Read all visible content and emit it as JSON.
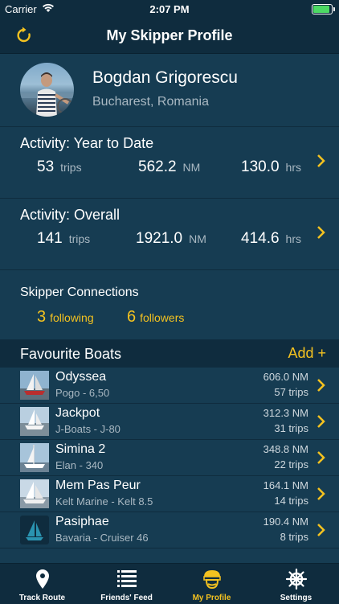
{
  "status_bar": {
    "carrier": "Carrier",
    "time": "2:07 PM"
  },
  "nav": {
    "title": "My Skipper Profile",
    "refresh_icon": "refresh-icon"
  },
  "profile": {
    "name": "Bogdan Grigorescu",
    "location": "Bucharest, Romania"
  },
  "activity_ytd": {
    "title": "Activity: Year to Date",
    "trips": "53",
    "trips_unit": "trips",
    "distance": "562.2",
    "distance_unit": "NM",
    "hours": "130.0",
    "hours_unit": "hrs"
  },
  "activity_overall": {
    "title": "Activity: Overall",
    "trips": "141",
    "trips_unit": "trips",
    "distance": "1921.0",
    "distance_unit": "NM",
    "hours": "414.6",
    "hours_unit": "hrs"
  },
  "connections": {
    "title": "Skipper Connections",
    "following_count": "3",
    "following_label": "following",
    "followers_count": "6",
    "followers_label": "followers"
  },
  "boats": {
    "title": "Favourite Boats",
    "add_label": "Add +",
    "items": [
      {
        "name": "Odyssea",
        "model": "Pogo - 6,50",
        "distance": "606.0 NM",
        "trips": "57 trips"
      },
      {
        "name": "Jackpot",
        "model": "J-Boats - J-80",
        "distance": "312.3 NM",
        "trips": "31 trips"
      },
      {
        "name": "Simina 2",
        "model": "Elan - 340",
        "distance": "348.8 NM",
        "trips": "22 trips"
      },
      {
        "name": "Mem Pas Peur",
        "model": "Kelt Marine - Kelt 8.5",
        "distance": "164.1 NM",
        "trips": "14 trips"
      },
      {
        "name": "Pasiphae",
        "model": "Bavaria - Cruiser 46",
        "distance": "190.4 NM",
        "trips": "8 trips"
      }
    ]
  },
  "tabs": [
    {
      "label": "Track Route",
      "icon": "location-pin-icon"
    },
    {
      "label": "Friends' Feed",
      "icon": "list-icon"
    },
    {
      "label": "My Profile",
      "icon": "skipper-cap-icon",
      "active": true
    },
    {
      "label": "Settings",
      "icon": "ship-wheel-icon"
    }
  ],
  "colors": {
    "background": "#163c52",
    "bar": "#0f2c3e",
    "accent": "#f4c220",
    "secondary_text": "#a9b8c2"
  }
}
